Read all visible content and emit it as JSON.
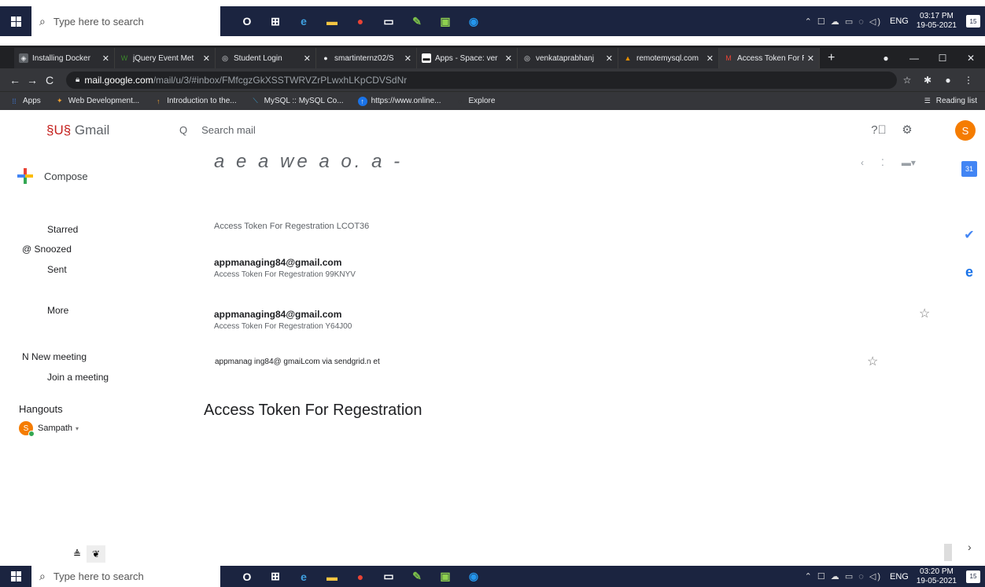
{
  "taskbar_top": {
    "search_placeholder": "Type here to search",
    "time": "03:17 PM",
    "date": "19-05-2021",
    "lang": "ENG",
    "notif_count": "15"
  },
  "taskbar_bottom": {
    "search_placeholder": "Type here to search",
    "time": "03:20 PM",
    "date": "19-05-2021",
    "lang": "ENG",
    "notif_count": "15"
  },
  "browser": {
    "tabs": [
      {
        "label": "Installing Docker",
        "icon": "docker-icon",
        "color": "#5f6368"
      },
      {
        "label": "jQuery Event Met",
        "icon": "w-icon",
        "color": "#3a8a2a"
      },
      {
        "label": "Student Login",
        "icon": "globe-icon",
        "color": "#888"
      },
      {
        "label": "smartinternz02/S",
        "icon": "github-icon",
        "color": "#fff"
      },
      {
        "label": "Apps - Space: ver",
        "icon": "apps-icon",
        "color": "#fff"
      },
      {
        "label": "venkataprabhanj",
        "icon": "globe-icon",
        "color": "#888"
      },
      {
        "label": "remotemysql.com",
        "icon": "mysql-icon",
        "color": "#e48e00"
      },
      {
        "label": "Access Token For R",
        "icon": "gmail-icon",
        "color": "#ea4335"
      }
    ],
    "url_host": "mail.google.com",
    "url_path": "/mail/u/3/#inbox/FMfcgzGkXSSTWRVZrPLwxhLKpCDVSdNr",
    "bookmarks": [
      {
        "label": "Apps",
        "icon": "apps-grid-icon"
      },
      {
        "label": "Web Development...",
        "icon": "bookmark-icon"
      },
      {
        "label": "Introduction to the...",
        "icon": "bookmark-icon"
      },
      {
        "label": "MySQL :: MySQL Co...",
        "icon": "mysql-icon"
      },
      {
        "label": "https://www.online...",
        "icon": "globe-icon"
      },
      {
        "label": "Explore",
        "icon": "explore-icon"
      }
    ],
    "reading_list": "Reading list"
  },
  "gmail": {
    "logo_mark": "§U§",
    "logo_text": "Gmail",
    "search_placeholder": "Search mail",
    "avatar_letter": "S",
    "compose": "Compose",
    "garbled_header": "a e a   we a o.  a -",
    "nav": {
      "starred": "Starred",
      "snoozed": "@ Snoozed",
      "sent": "Sent",
      "more": "More",
      "new_meeting": "N New meeting",
      "join_meeting": "Join a meeting",
      "hangouts": "Hangouts",
      "hangouts_user": "Sampath"
    },
    "mails": [
      {
        "subject": "Access Token For Regestration LCOT36"
      },
      {
        "from": "appmanaging84@gmail.com",
        "subject": "Access Token For Regestration 99KNYV"
      },
      {
        "from": "appmanaging84@gmail.com",
        "subject": "Access Token For Regestration Y64J00"
      }
    ],
    "sender_line": "appmanag ing84@ gmaiLcom via  sendgrid.n et",
    "opened_subject": "Access Token For Regestration"
  }
}
